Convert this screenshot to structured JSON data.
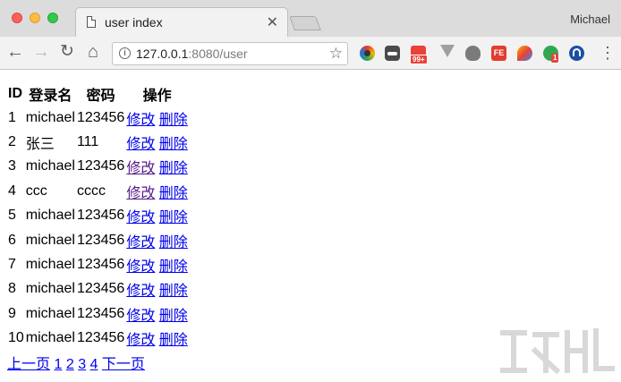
{
  "window": {
    "tab_title": "user index",
    "profile_name": "Michael",
    "url_host": "127.0.0.1",
    "url_rest": ":8080/user"
  },
  "extensions": {
    "ext3_badge": "99+",
    "ext6_label": "FE",
    "ext8_badge": "1"
  },
  "table": {
    "headers": [
      "ID",
      "登录名",
      "密码",
      "操作"
    ],
    "edit_label": "修改",
    "delete_label": "删除",
    "rows": [
      {
        "id": "1",
        "name": "michael",
        "password": "123456"
      },
      {
        "id": "2",
        "name": "张三",
        "password": "111"
      },
      {
        "id": "3",
        "name": "michael",
        "password": "123456"
      },
      {
        "id": "4",
        "name": "ccc",
        "password": "cccc"
      },
      {
        "id": "5",
        "name": "michael",
        "password": "123456"
      },
      {
        "id": "6",
        "name": "michael",
        "password": "123456"
      },
      {
        "id": "7",
        "name": "michael",
        "password": "123456"
      },
      {
        "id": "8",
        "name": "michael",
        "password": "123456"
      },
      {
        "id": "9",
        "name": "michael",
        "password": "123456"
      },
      {
        "id": "10",
        "name": "michael",
        "password": "123456"
      }
    ]
  },
  "pager": {
    "prev": "上一页",
    "pages": [
      "1",
      "2",
      "3",
      "4"
    ],
    "next": "下一页"
  },
  "colors": {
    "link": "#0000ee",
    "visited_link": "#551a8b"
  }
}
